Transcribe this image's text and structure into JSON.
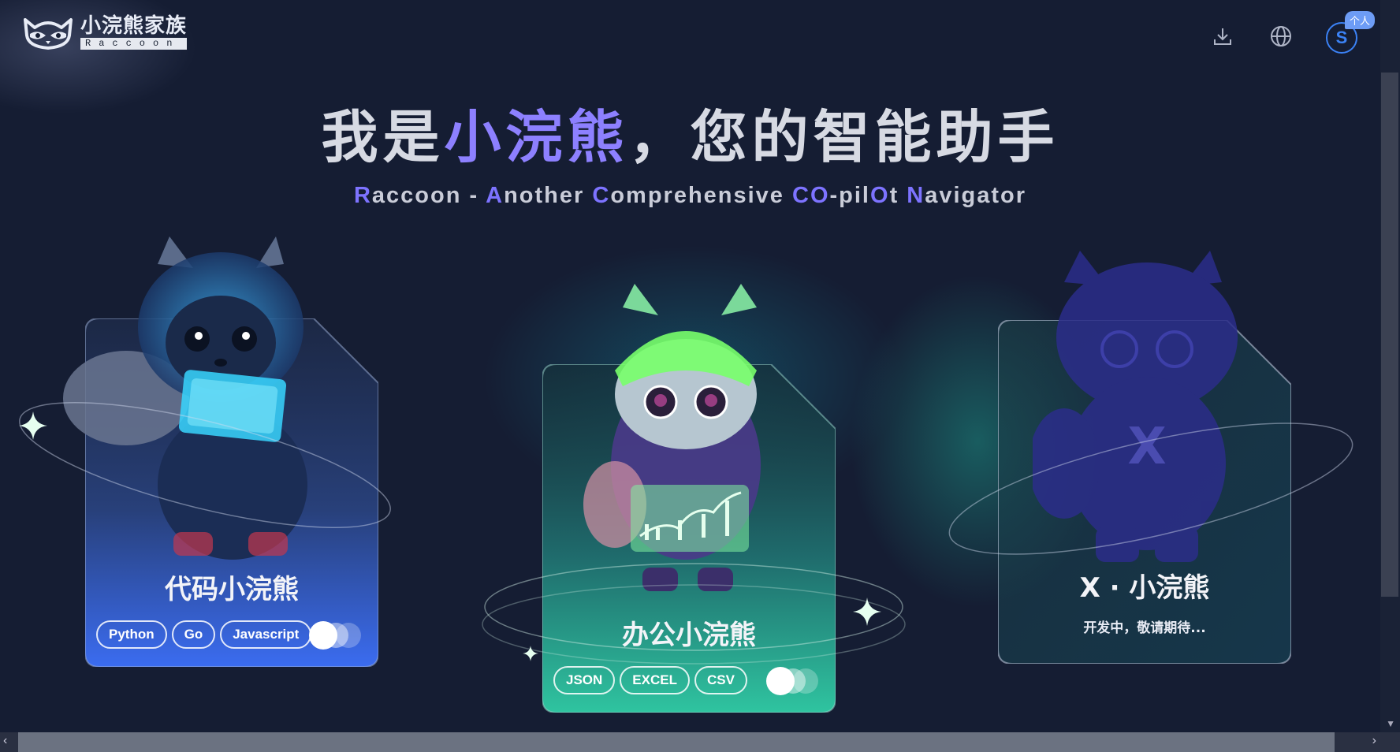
{
  "brand": {
    "name_cn": "小浣熊家族",
    "name_en": "Raccoon"
  },
  "topbar": {
    "icons": [
      "download-icon",
      "globe-icon"
    ],
    "avatar_letter": "S",
    "badge": "个人"
  },
  "hero": {
    "title_part1": "我是",
    "title_accent": "小浣熊",
    "title_part2": "，您的智能助手",
    "subtitle_segments": [
      {
        "text": "R",
        "hl": true
      },
      {
        "text": "accoon - ",
        "hl": false
      },
      {
        "text": "A",
        "hl": true
      },
      {
        "text": "nother ",
        "hl": false
      },
      {
        "text": "C",
        "hl": true
      },
      {
        "text": "omprehensive ",
        "hl": false
      },
      {
        "text": "CO",
        "hl": true
      },
      {
        "text": "-pil",
        "hl": false
      },
      {
        "text": "O",
        "hl": true
      },
      {
        "text": "t ",
        "hl": false
      },
      {
        "text": "N",
        "hl": true
      },
      {
        "text": "avigator",
        "hl": false
      }
    ]
  },
  "cards": {
    "code": {
      "title": "代码小浣熊",
      "tags": [
        "Python",
        "Go",
        "Javascript"
      ],
      "color_top": "#1f2d4d",
      "color_bottom": "#3b6cf0"
    },
    "office": {
      "title": "办公小浣熊",
      "tags": [
        "JSON",
        "EXCEL",
        "CSV"
      ],
      "color_top": "#15303a",
      "color_bottom": "#2fc4a0"
    },
    "x": {
      "title": "X · 小浣熊",
      "subtitle": "开发中，敬请期待...",
      "mascot_letter": "X"
    }
  },
  "colors": {
    "background": "#151d33",
    "accent_purple": "#8d80ff",
    "avatar_blue": "#3b82f6"
  }
}
